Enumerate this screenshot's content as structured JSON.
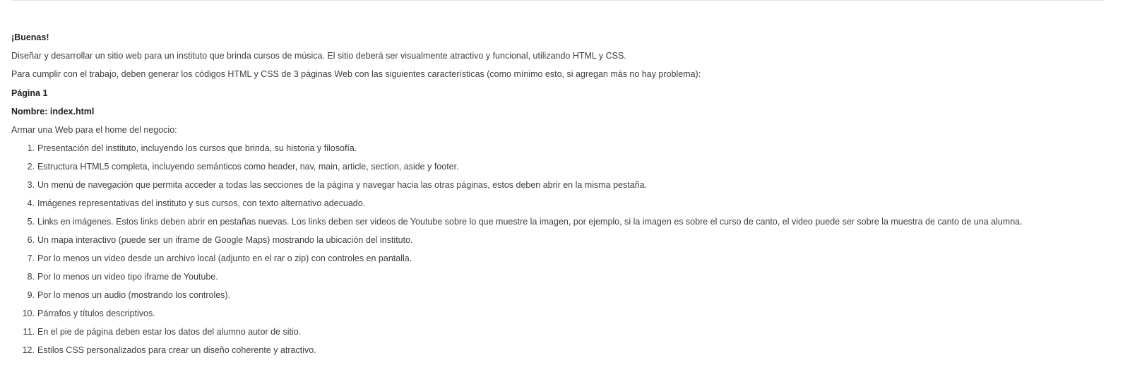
{
  "document": {
    "greeting": "¡Buenas!",
    "intro_1": "Diseñar y desarrollar un sitio web para un instituto que brinda cursos de música. El sitio deberá ser visualmente atractivo y funcional, utilizando HTML y CSS.",
    "intro_2": "Para cumplir con el trabajo, deben generar los códigos HTML y CSS de 3 páginas Web con las siguientes características (como mínimo esto, si agregan más no hay problema):",
    "page_heading": "Página 1",
    "page_name": "Nombre:  index.html",
    "page_desc": "Armar una Web para el home del negocio:",
    "requirements": [
      {
        "num": "1.",
        "text": "Presentación del instituto, incluyendo los cursos que brinda, su historia y filosofía."
      },
      {
        "num": "2.",
        "text": "Estructura HTML5 completa, incluyendo semánticos como header, nav, main, article, section, aside y footer."
      },
      {
        "num": "3.",
        "text": "Un menú de navegación que permita acceder a todas las secciones de la página y navegar hacia las otras páginas, estos deben abrir en la misma pestaña."
      },
      {
        "num": "4.",
        "text": "Imágenes representativas del instituto y sus cursos, con texto alternativo adecuado."
      },
      {
        "num": "5.",
        "text": "Links en imágenes. Estos links deben abrir en pestañas nuevas. Los links deben ser videos de Youtube sobre lo que muestre la imagen, por ejemplo, si la imagen es sobre el curso de canto, el video puede ser sobre la muestra de canto de una alumna."
      },
      {
        "num": "6.",
        "text": "Un mapa interactivo (puede ser un iframe de Google Maps) mostrando la ubicación del instituto."
      },
      {
        "num": "7.",
        "text": "Por lo menos un video desde un archivo local (adjunto en el rar o zip) con controles en pantalla."
      },
      {
        "num": "8.",
        "text": "Por lo menos un video tipo iframe de Youtube."
      },
      {
        "num": "9.",
        "text": "Por lo menos un audio (mostrando los controles)."
      },
      {
        "num": "10.",
        "text": "Párrafos y títulos descriptivos."
      },
      {
        "num": "11.",
        "text": "En el pie de página deben estar los datos del alumno autor de sitio."
      },
      {
        "num": "12.",
        "text": "Estilos CSS personalizados para crear un diseño coherente y atractivo."
      }
    ]
  }
}
